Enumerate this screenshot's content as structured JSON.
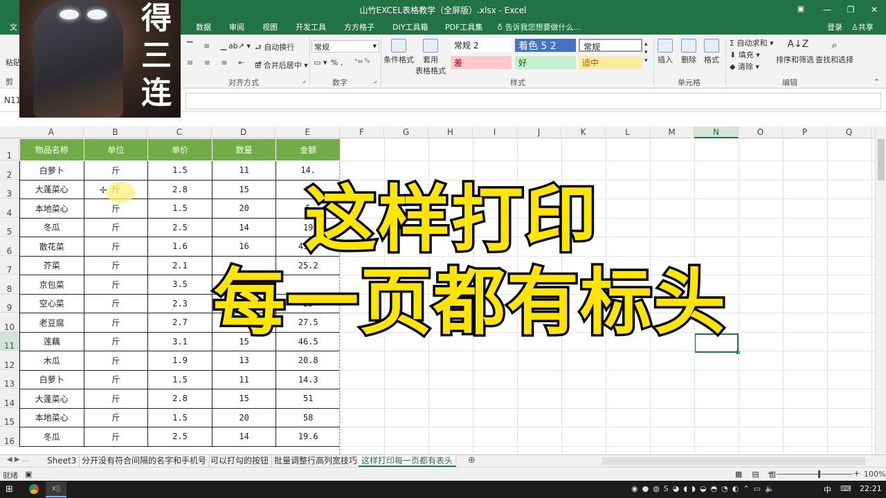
{
  "window": {
    "title": "山竹EXCEL表格教学（全屏版）.xlsx - Excel"
  },
  "menu": {
    "tabs": [
      "文",
      "数据",
      "审阅",
      "视图",
      "开发工具",
      "方方格子",
      "DIY工具箱",
      "PDF工具集"
    ],
    "tellme": "告诉我您想要做什么...",
    "login": "登录",
    "share": "共享"
  },
  "ribbon": {
    "paste": "粘贴",
    "clipboard": "剪",
    "wrap_text": "自动换行",
    "merge_center": "合并后居中",
    "align_group": "对齐方式",
    "number_format": "常规",
    "percent_symbols": "% ,",
    "number_group": "数字",
    "cond_format": "条件格式",
    "table_format_1": "套用",
    "table_format_2": "表格格式",
    "styles_group": "样式",
    "style_normal2": "常规 2",
    "style_accent52": "着色 5 2",
    "style_normal": "常规",
    "style_bad": "差",
    "style_good": "好",
    "style_neutral": "适中",
    "insert": "插入",
    "delete": "删除",
    "format": "格式",
    "cells_group": "单元格",
    "autosum": "自动求和",
    "fill": "填充",
    "clear": "清除",
    "sort_filter": "排序和筛选",
    "find_select": "查找和选择",
    "edit_group": "编辑"
  },
  "formula_bar": {
    "name_box": "N11"
  },
  "grid": {
    "columns": [
      "A",
      "B",
      "C",
      "D",
      "E",
      "F",
      "G",
      "H",
      "I",
      "J",
      "K",
      "L",
      "M",
      "N",
      "O",
      "P",
      "Q"
    ],
    "selected_column": "N",
    "rows": [
      "1",
      "2",
      "3",
      "4",
      "5",
      "6",
      "7",
      "8",
      "9",
      "10",
      "11",
      "12",
      "13",
      "14",
      "15",
      "16"
    ],
    "selected_row": "11",
    "headers": [
      "物品名称",
      "单位",
      "单价",
      "数量",
      "金额"
    ],
    "data": [
      [
        "白萝卜",
        "斤",
        "1.5",
        "11",
        "14."
      ],
      [
        "大蓬菜心",
        "斤",
        "2.8",
        "15",
        "5"
      ],
      [
        "本地菜心",
        "斤",
        "1.5",
        "20",
        "5"
      ],
      [
        "冬瓜",
        "斤",
        "2.5",
        "14",
        "19"
      ],
      [
        "散花菜",
        "斤",
        "1.6",
        "16",
        "41.6"
      ],
      [
        "芥菜",
        "斤",
        "2.1",
        "",
        "25.2"
      ],
      [
        "京包菜",
        "斤",
        "3.5",
        "",
        ""
      ],
      [
        "空心菜",
        "斤",
        "2.3",
        "",
        "23"
      ],
      [
        "老豆腐",
        "斤",
        "2.7",
        "",
        "27.5"
      ],
      [
        "莲藕",
        "斤",
        "3.1",
        "15",
        "46.5"
      ],
      [
        "木瓜",
        "斤",
        "1.9",
        "13",
        "20.8"
      ],
      [
        "白萝卜",
        "斤",
        "1.5",
        "11",
        "14.3"
      ],
      [
        "大蓬菜心",
        "斤",
        "2.8",
        "15",
        "51"
      ],
      [
        "本地菜心",
        "斤",
        "1.5",
        "20",
        "58"
      ],
      [
        "冬瓜",
        "斤",
        "2.5",
        "14",
        "19.6"
      ]
    ]
  },
  "overlay": {
    "line1": "这样打印",
    "line2": "每一页都有标头",
    "thumb_text": [
      "得",
      "三",
      "连"
    ]
  },
  "sheets": {
    "nav": "◀ ▶ ...",
    "tabs": [
      "Sheet3",
      "分开没有符合间隔的名字和手机号",
      "可以打勾的按钮",
      "批量调整行高列宽技巧",
      "这样打印每一页都有表头"
    ],
    "active": 4,
    "add": "⊕"
  },
  "status": {
    "ready": "就绪",
    "zoom": "100%"
  },
  "taskbar": {
    "ime": "中",
    "clock": "22:21"
  }
}
